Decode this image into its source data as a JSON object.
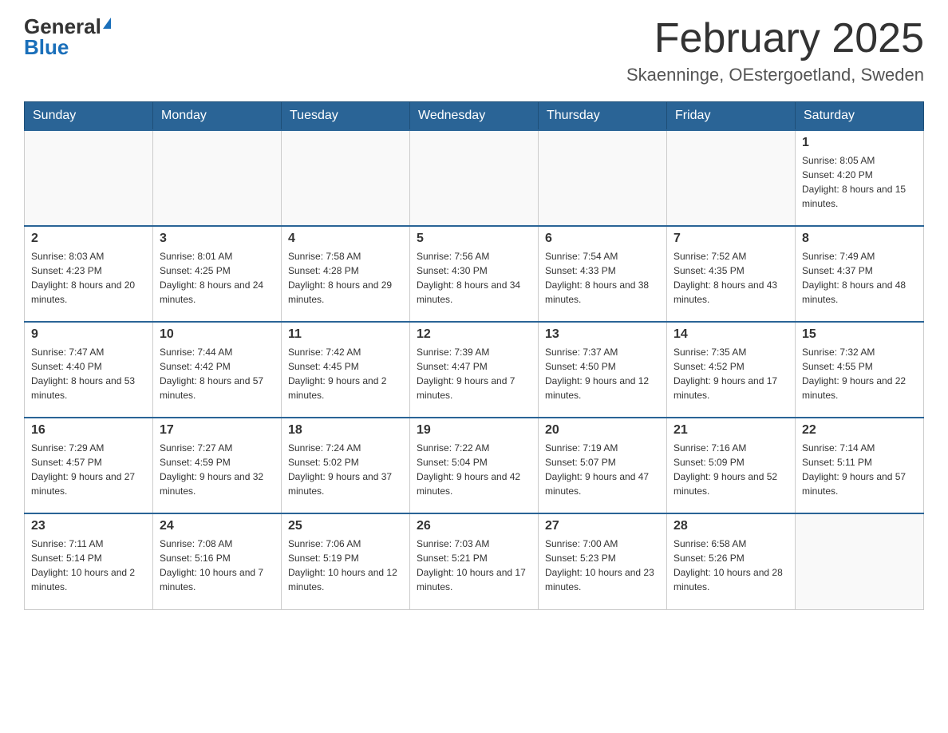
{
  "logo": {
    "general": "General",
    "blue": "Blue"
  },
  "title": "February 2025",
  "subtitle": "Skaenninge, OEstergoetland, Sweden",
  "days_of_week": [
    "Sunday",
    "Monday",
    "Tuesday",
    "Wednesday",
    "Thursday",
    "Friday",
    "Saturday"
  ],
  "weeks": [
    [
      {
        "date": "",
        "info": ""
      },
      {
        "date": "",
        "info": ""
      },
      {
        "date": "",
        "info": ""
      },
      {
        "date": "",
        "info": ""
      },
      {
        "date": "",
        "info": ""
      },
      {
        "date": "",
        "info": ""
      },
      {
        "date": "1",
        "info": "Sunrise: 8:05 AM\nSunset: 4:20 PM\nDaylight: 8 hours and 15 minutes."
      }
    ],
    [
      {
        "date": "2",
        "info": "Sunrise: 8:03 AM\nSunset: 4:23 PM\nDaylight: 8 hours and 20 minutes."
      },
      {
        "date": "3",
        "info": "Sunrise: 8:01 AM\nSunset: 4:25 PM\nDaylight: 8 hours and 24 minutes."
      },
      {
        "date": "4",
        "info": "Sunrise: 7:58 AM\nSunset: 4:28 PM\nDaylight: 8 hours and 29 minutes."
      },
      {
        "date": "5",
        "info": "Sunrise: 7:56 AM\nSunset: 4:30 PM\nDaylight: 8 hours and 34 minutes."
      },
      {
        "date": "6",
        "info": "Sunrise: 7:54 AM\nSunset: 4:33 PM\nDaylight: 8 hours and 38 minutes."
      },
      {
        "date": "7",
        "info": "Sunrise: 7:52 AM\nSunset: 4:35 PM\nDaylight: 8 hours and 43 minutes."
      },
      {
        "date": "8",
        "info": "Sunrise: 7:49 AM\nSunset: 4:37 PM\nDaylight: 8 hours and 48 minutes."
      }
    ],
    [
      {
        "date": "9",
        "info": "Sunrise: 7:47 AM\nSunset: 4:40 PM\nDaylight: 8 hours and 53 minutes."
      },
      {
        "date": "10",
        "info": "Sunrise: 7:44 AM\nSunset: 4:42 PM\nDaylight: 8 hours and 57 minutes."
      },
      {
        "date": "11",
        "info": "Sunrise: 7:42 AM\nSunset: 4:45 PM\nDaylight: 9 hours and 2 minutes."
      },
      {
        "date": "12",
        "info": "Sunrise: 7:39 AM\nSunset: 4:47 PM\nDaylight: 9 hours and 7 minutes."
      },
      {
        "date": "13",
        "info": "Sunrise: 7:37 AM\nSunset: 4:50 PM\nDaylight: 9 hours and 12 minutes."
      },
      {
        "date": "14",
        "info": "Sunrise: 7:35 AM\nSunset: 4:52 PM\nDaylight: 9 hours and 17 minutes."
      },
      {
        "date": "15",
        "info": "Sunrise: 7:32 AM\nSunset: 4:55 PM\nDaylight: 9 hours and 22 minutes."
      }
    ],
    [
      {
        "date": "16",
        "info": "Sunrise: 7:29 AM\nSunset: 4:57 PM\nDaylight: 9 hours and 27 minutes."
      },
      {
        "date": "17",
        "info": "Sunrise: 7:27 AM\nSunset: 4:59 PM\nDaylight: 9 hours and 32 minutes."
      },
      {
        "date": "18",
        "info": "Sunrise: 7:24 AM\nSunset: 5:02 PM\nDaylight: 9 hours and 37 minutes."
      },
      {
        "date": "19",
        "info": "Sunrise: 7:22 AM\nSunset: 5:04 PM\nDaylight: 9 hours and 42 minutes."
      },
      {
        "date": "20",
        "info": "Sunrise: 7:19 AM\nSunset: 5:07 PM\nDaylight: 9 hours and 47 minutes."
      },
      {
        "date": "21",
        "info": "Sunrise: 7:16 AM\nSunset: 5:09 PM\nDaylight: 9 hours and 52 minutes."
      },
      {
        "date": "22",
        "info": "Sunrise: 7:14 AM\nSunset: 5:11 PM\nDaylight: 9 hours and 57 minutes."
      }
    ],
    [
      {
        "date": "23",
        "info": "Sunrise: 7:11 AM\nSunset: 5:14 PM\nDaylight: 10 hours and 2 minutes."
      },
      {
        "date": "24",
        "info": "Sunrise: 7:08 AM\nSunset: 5:16 PM\nDaylight: 10 hours and 7 minutes."
      },
      {
        "date": "25",
        "info": "Sunrise: 7:06 AM\nSunset: 5:19 PM\nDaylight: 10 hours and 12 minutes."
      },
      {
        "date": "26",
        "info": "Sunrise: 7:03 AM\nSunset: 5:21 PM\nDaylight: 10 hours and 17 minutes."
      },
      {
        "date": "27",
        "info": "Sunrise: 7:00 AM\nSunset: 5:23 PM\nDaylight: 10 hours and 23 minutes."
      },
      {
        "date": "28",
        "info": "Sunrise: 6:58 AM\nSunset: 5:26 PM\nDaylight: 10 hours and 28 minutes."
      },
      {
        "date": "",
        "info": ""
      }
    ]
  ]
}
